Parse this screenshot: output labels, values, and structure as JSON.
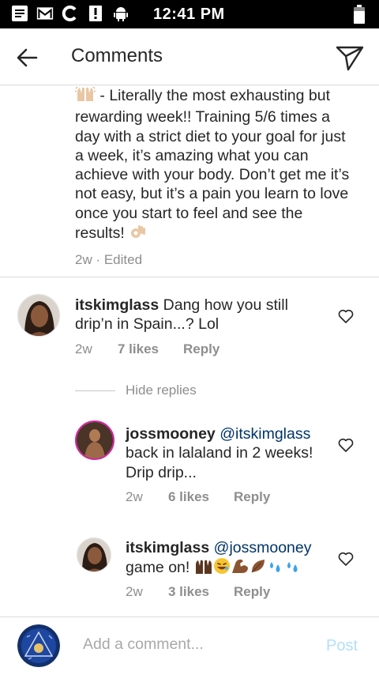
{
  "status_bar": {
    "time": "12:41 PM",
    "icons": [
      "notes-icon",
      "gmail-icon",
      "c-app-icon",
      "alert-icon",
      "android-icon"
    ],
    "battery_icon": "battery-icon"
  },
  "header": {
    "title": "Comments",
    "back_icon": "back-arrow-icon",
    "send_icon": "send-icon"
  },
  "caption": {
    "text_prefix": "- Literally the most exhausting but rewarding week!! Training 5/6 times a day with a strict diet to your goal for just a week, it’s amazing what you can achieve with your body. Don’t get me it’s not easy, but it’s a pain you learn to love once you start to feel and see the results!",
    "leading_emoji": "raised-hands-emoji",
    "trailing_emoji": "ok-hand-emoji",
    "meta": "2w · Edited"
  },
  "comments": [
    {
      "username": "itskimglass",
      "text": "Dang how you still drip’n in Spain...? Lol",
      "time": "2w",
      "likes": "7 likes",
      "reply": "Reply"
    }
  ],
  "hide_replies": "Hide replies",
  "replies": [
    {
      "username": "jossmooney",
      "mention": "@itskimglass",
      "text": "back in lalaland in 2 weeks! Drip drip...",
      "time": "2w",
      "likes": "6 likes",
      "reply": "Reply"
    },
    {
      "username": "itskimglass",
      "mention": "@jossmooney",
      "text": "game on!",
      "emojis": [
        "raised-hands-emoji",
        "grin-emoji",
        "flexed-biceps-emoji",
        "leaf-emoji",
        "sweat-droplets-emoji",
        "sweat-droplets-emoji"
      ],
      "time": "2w",
      "likes": "3 likes",
      "reply": "Reply"
    }
  ],
  "composer": {
    "placeholder": "Add a comment...",
    "post_label": "Post"
  },
  "colors": {
    "text": "#262626",
    "meta": "#8e8e8e",
    "mention": "#003569",
    "post_disabled": "#b2dffc",
    "divider": "#dbdbdb"
  }
}
